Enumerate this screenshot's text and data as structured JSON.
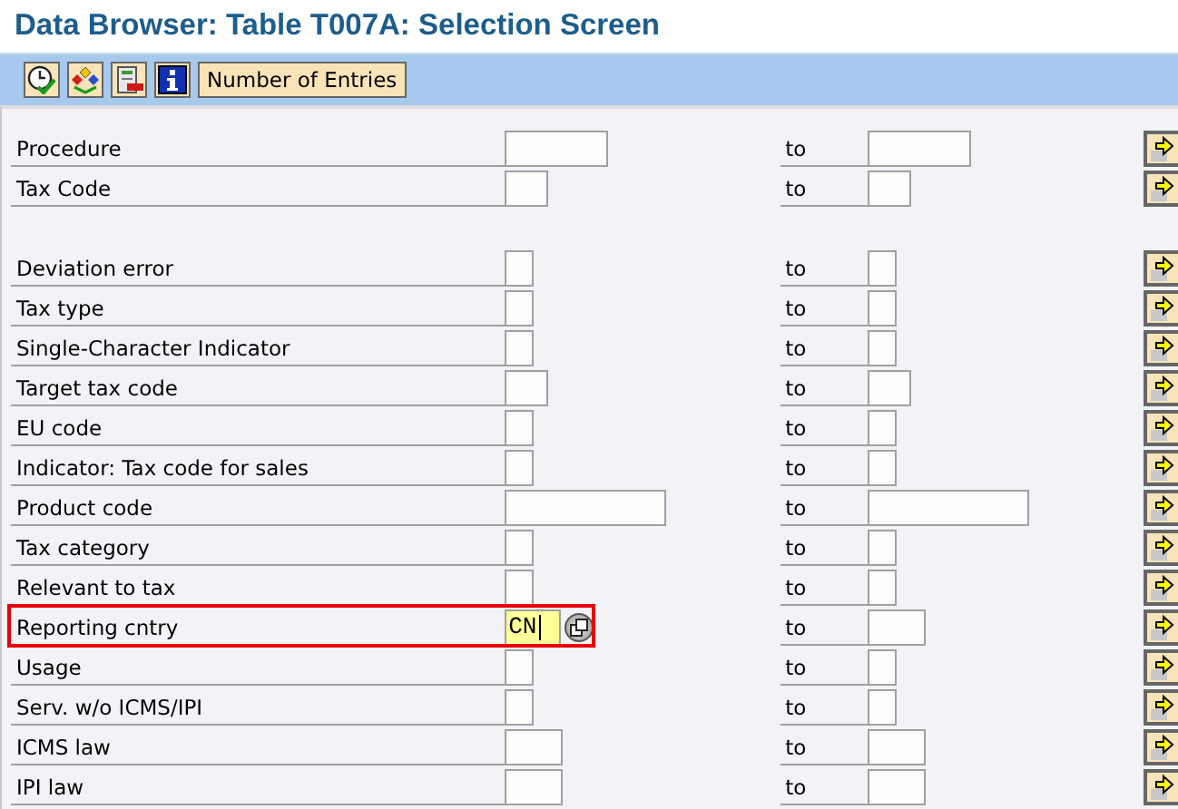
{
  "window": {
    "title": "Data Browser: Table T007A: Selection Screen"
  },
  "toolbar": {
    "icon_buttons": [
      {
        "kind": "execute"
      },
      {
        "kind": "selection"
      },
      {
        "kind": "delete"
      },
      {
        "kind": "info"
      }
    ],
    "text_button": "Number of Entries"
  },
  "groups": [
    {
      "rows": [
        {
          "label": "Procedure",
          "to": "to",
          "highlighted": false,
          "active": false
        },
        {
          "label": "Tax Code",
          "to": "to",
          "highlighted": false,
          "active": false
        }
      ]
    },
    {
      "rows": [
        {
          "label": "Deviation error",
          "to": "to",
          "highlighted": false,
          "active": false
        },
        {
          "label": "Tax type",
          "to": "to",
          "highlighted": false,
          "active": false
        },
        {
          "label": "Single-Character Indicator",
          "to": "to",
          "highlighted": false,
          "active": false
        },
        {
          "label": "Target tax code",
          "to": "to",
          "highlighted": false,
          "active": false
        },
        {
          "label": "EU code",
          "to": "to",
          "highlighted": false,
          "active": false
        },
        {
          "label": "Indicator: Tax code for sales",
          "to": "to",
          "highlighted": false,
          "active": false
        },
        {
          "label": "Product code",
          "to": "to",
          "highlighted": false,
          "active": false
        },
        {
          "label": "Tax category",
          "to": "to",
          "highlighted": false,
          "active": false
        },
        {
          "label": "Relevant to tax",
          "to": "to",
          "highlighted": false,
          "active": false
        },
        {
          "label": "Reporting cntry",
          "value": "CN",
          "to": "to",
          "highlighted": true,
          "active": true
        },
        {
          "label": "Usage",
          "to": "to",
          "highlighted": false,
          "active": false
        },
        {
          "label": "Serv. w/o ICMS/IPI",
          "to": "to",
          "highlighted": false,
          "active": false
        },
        {
          "label": "ICMS law",
          "to": "to",
          "highlighted": false,
          "active": false
        },
        {
          "label": "IPI law",
          "to": "to",
          "highlighted": false,
          "active": false
        }
      ]
    }
  ]
}
